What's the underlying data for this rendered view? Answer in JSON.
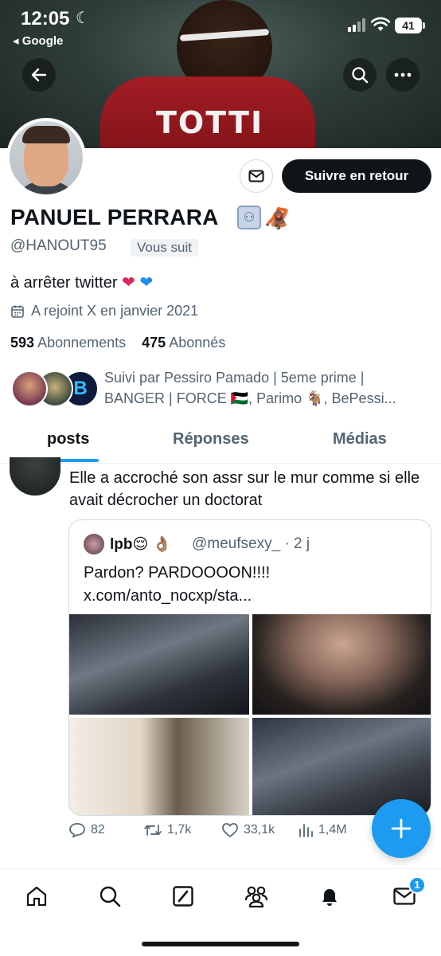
{
  "status_bar": {
    "time": "12:05",
    "back_app": "◂ Google",
    "battery": "41"
  },
  "banner": {
    "shirt_text": "TOTTI"
  },
  "profile": {
    "name": "PANUEL PERRARA",
    "handle": "@HANOUT95",
    "follows_you": "Vous suit",
    "bio": "à arrêter twitter",
    "joined": "A rejoint X en janvier 2021",
    "following_count": "593",
    "following_label": "Abonnements",
    "followers_count": "475",
    "followers_label": "Abonnés",
    "followed_by": "Suivi par Pessiro Pamado | 5eme prime | BANGER | FORCE 🇵🇸, Parimo 🐐, BePessi...",
    "follow_button": "Suivre en retour",
    "followed_avatar_letter": "B"
  },
  "tabs": [
    {
      "label": "posts",
      "active": true
    },
    {
      "label": "Réponses",
      "active": false
    },
    {
      "label": "Médias",
      "active": false
    }
  ],
  "post": {
    "text": "Elle a accroché son assr sur le mur comme si elle avait décrocher un doctorat",
    "quote": {
      "name": "lpb",
      "name_emoji": "😌 👌🏽",
      "handle_time": "@meufsexy_ · 2 j",
      "text": "Pardon? PARDOOOON!!!! x.com/anto_nocxp/sta..."
    },
    "actions": {
      "replies": "82",
      "reposts": "1,7k",
      "likes": "33,1k",
      "views": "1,4M"
    }
  },
  "nav": {
    "messages_badge": "1"
  },
  "colors": {
    "accent": "#1d9bf0",
    "text": "#0f1419",
    "muted": "#536471"
  }
}
